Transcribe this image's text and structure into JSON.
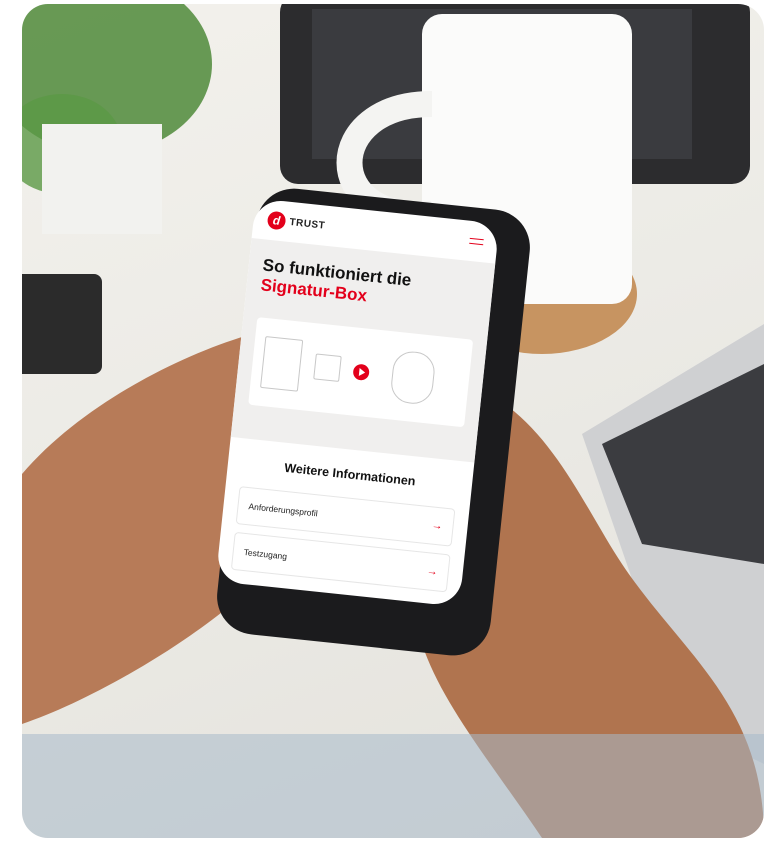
{
  "logo_text": "TRUST",
  "hero": {
    "title_line1": "So funktioniert die",
    "title_line2": "Signatur-Box"
  },
  "info": {
    "heading": "Weitere Informationen",
    "links": [
      {
        "label": "Anforderungsprofil"
      },
      {
        "label": "Testzugang"
      }
    ]
  },
  "icons": [
    "logo-mark-icon",
    "menu-icon",
    "play-icon",
    "arrow-right-icon"
  ],
  "colors": {
    "accent": "#e3001b"
  }
}
